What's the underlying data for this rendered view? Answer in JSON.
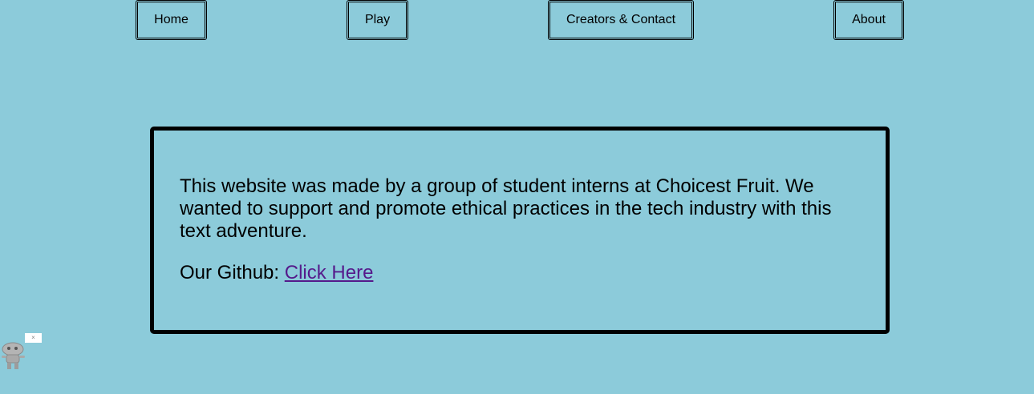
{
  "nav": {
    "home": "Home",
    "play": "Play",
    "creators": "Creators & Contact",
    "about": "About"
  },
  "about": {
    "description": "This website was made by a group of student interns at Choicest Fruit. We wanted to support and promote ethical practices in the tech industry with this text adventure.",
    "github_label": "Our Github:",
    "github_link": "Click Here"
  },
  "mascot": {
    "close_symbol": "×",
    "icon": "robot-mascot-icon"
  }
}
